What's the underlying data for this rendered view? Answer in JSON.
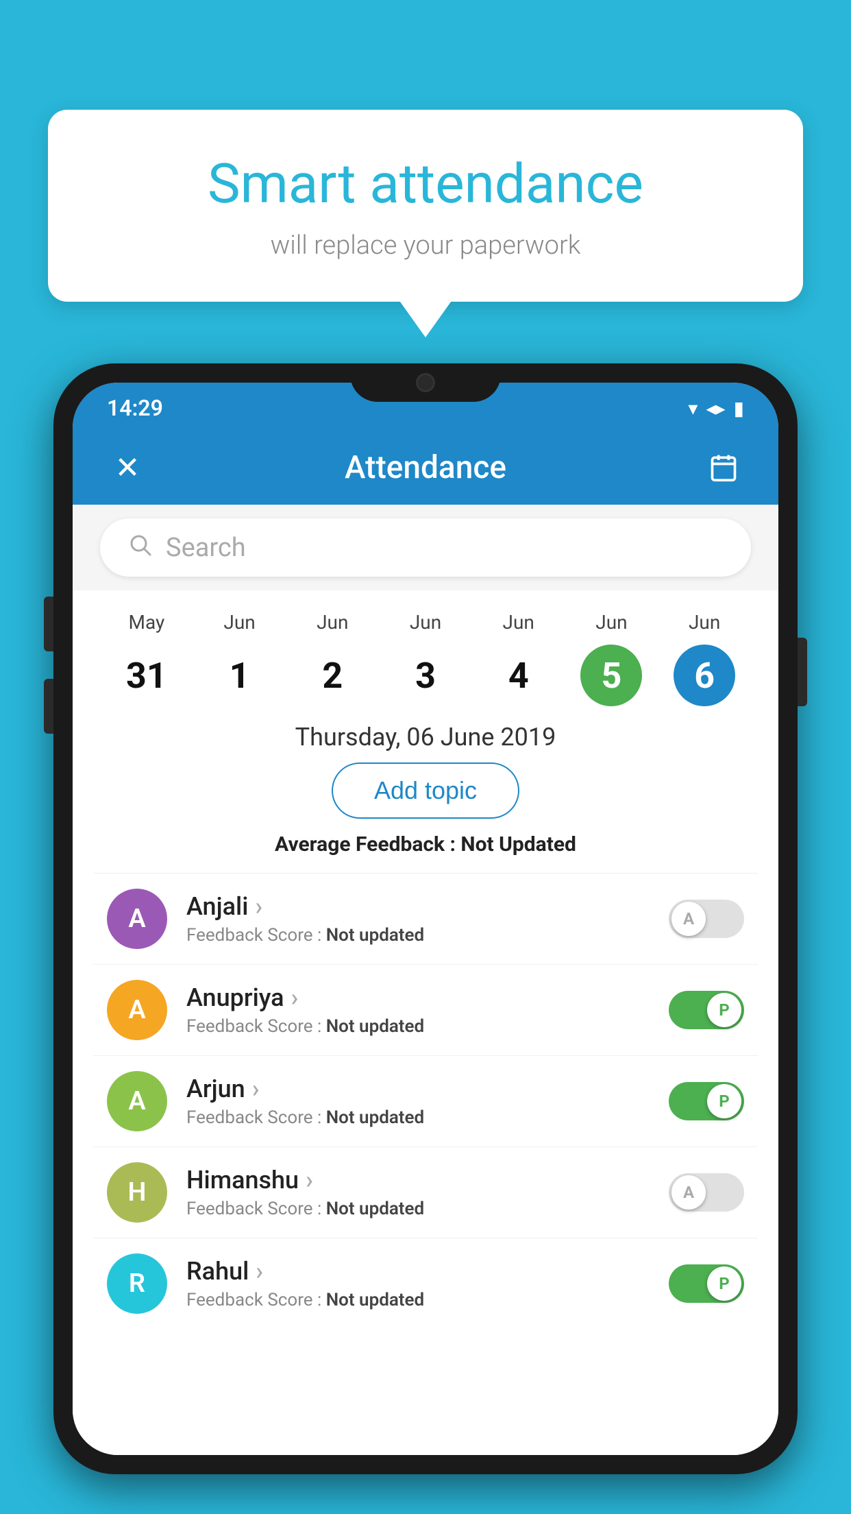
{
  "app": {
    "background_color": "#29B6D8"
  },
  "bubble": {
    "title": "Smart attendance",
    "subtitle": "will replace your paperwork"
  },
  "status_bar": {
    "time": "14:29",
    "wifi_icon": "▼",
    "signal_icon": "▲",
    "battery_icon": "▮"
  },
  "app_bar": {
    "title": "Attendance",
    "close_label": "✕",
    "calendar_label": "📅"
  },
  "search": {
    "placeholder": "Search"
  },
  "calendar": {
    "days": [
      {
        "month": "May",
        "date": "31",
        "state": "normal"
      },
      {
        "month": "Jun",
        "date": "1",
        "state": "normal"
      },
      {
        "month": "Jun",
        "date": "2",
        "state": "normal"
      },
      {
        "month": "Jun",
        "date": "3",
        "state": "normal"
      },
      {
        "month": "Jun",
        "date": "4",
        "state": "normal"
      },
      {
        "month": "Jun",
        "date": "5",
        "state": "today"
      },
      {
        "month": "Jun",
        "date": "6",
        "state": "selected"
      }
    ]
  },
  "selected_date": "Thursday, 06 June 2019",
  "add_topic_label": "Add topic",
  "average_feedback": {
    "label": "Average Feedback : ",
    "value": "Not Updated"
  },
  "students": [
    {
      "name": "Anjali",
      "avatar_letter": "A",
      "avatar_color": "#9B59B6",
      "feedback_label": "Feedback Score : ",
      "feedback_value": "Not updated",
      "toggle_state": "off",
      "toggle_letter": "A"
    },
    {
      "name": "Anupriya",
      "avatar_letter": "A",
      "avatar_color": "#F5A623",
      "feedback_label": "Feedback Score : ",
      "feedback_value": "Not updated",
      "toggle_state": "on",
      "toggle_letter": "P"
    },
    {
      "name": "Arjun",
      "avatar_letter": "A",
      "avatar_color": "#8BC34A",
      "feedback_label": "Feedback Score : ",
      "feedback_value": "Not updated",
      "toggle_state": "on",
      "toggle_letter": "P"
    },
    {
      "name": "Himanshu",
      "avatar_letter": "H",
      "avatar_color": "#AABB55",
      "feedback_label": "Feedback Score : ",
      "feedback_value": "Not updated",
      "toggle_state": "off",
      "toggle_letter": "A"
    },
    {
      "name": "Rahul",
      "avatar_letter": "R",
      "avatar_color": "#26C6DA",
      "feedback_label": "Feedback Score : ",
      "feedback_value": "Not updated",
      "toggle_state": "on",
      "toggle_letter": "P"
    }
  ]
}
